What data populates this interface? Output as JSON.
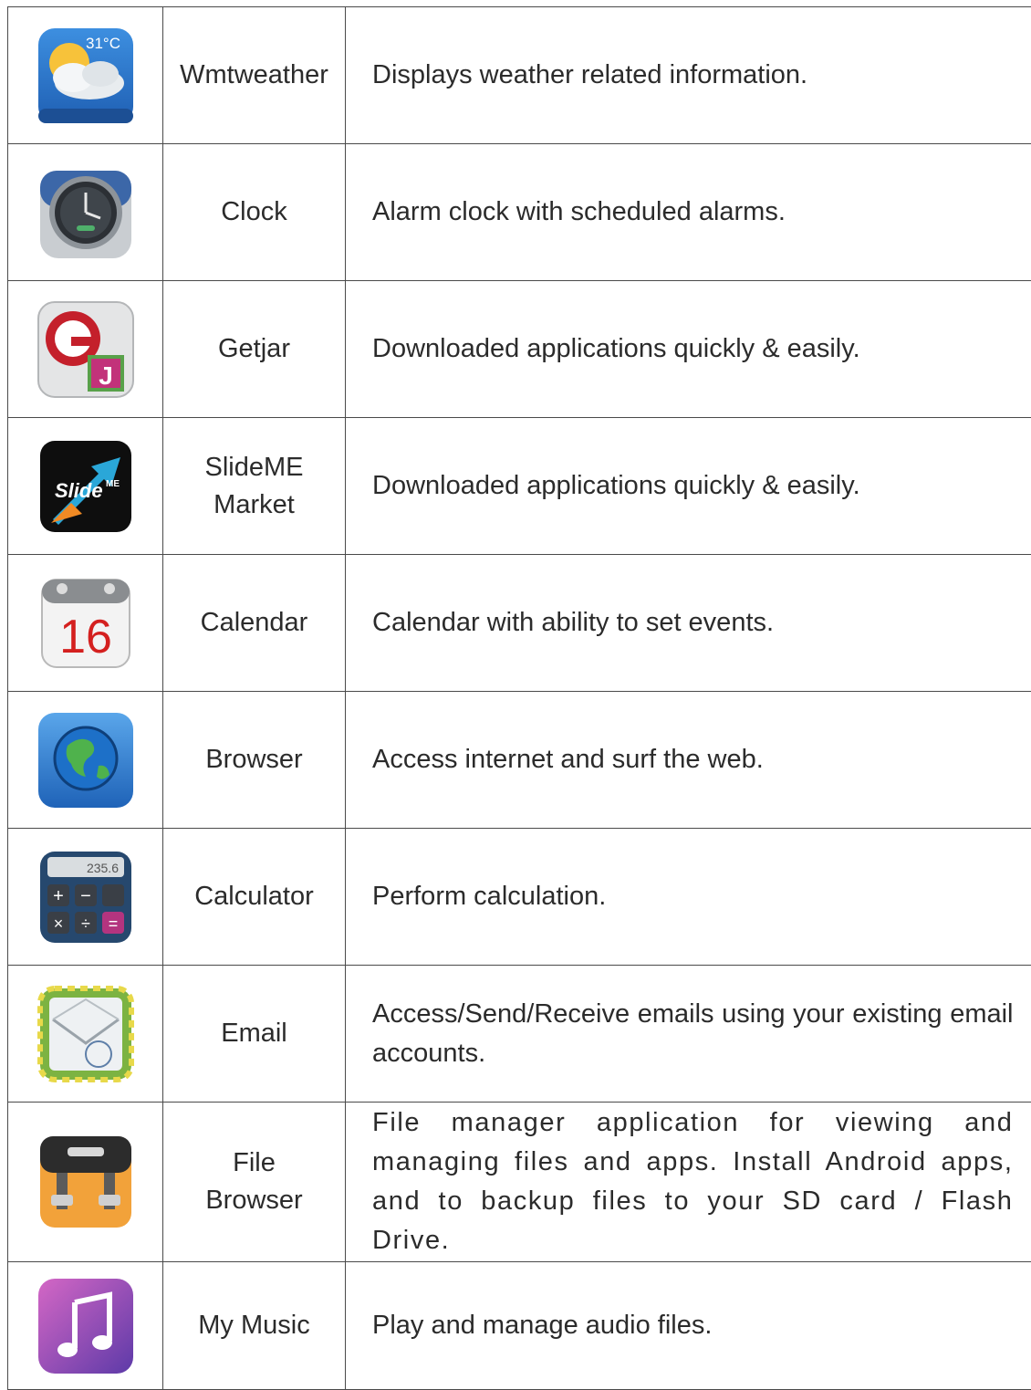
{
  "apps": [
    {
      "name": "Wmtweather",
      "description": "Displays weather related information.",
      "icon": "weather-icon",
      "icon_text": "31°C"
    },
    {
      "name": "Clock",
      "description": "Alarm clock with scheduled alarms.",
      "icon": "alarm-clock-icon"
    },
    {
      "name": "Getjar",
      "description": "Downloaded applications quickly & easily.",
      "icon": "getjar-icon",
      "icon_text": "G J"
    },
    {
      "name": "SlideME\nMarket",
      "description": "Downloaded applications quickly & easily.",
      "icon": "slideme-icon",
      "icon_text": "Slide ME"
    },
    {
      "name": "Calendar",
      "description": "Calendar with ability to set events.",
      "icon": "calendar-icon",
      "icon_text": "16"
    },
    {
      "name": "Browser",
      "description": "Access internet and surf the web.",
      "icon": "globe-icon"
    },
    {
      "name": "Calculator",
      "description": "Perform calculation.",
      "icon": "calculator-icon",
      "icon_text": "235.6"
    },
    {
      "name": "Email",
      "description": "Access/Send/Receive emails using your existing email accounts.",
      "icon": "envelope-icon"
    },
    {
      "name": "File\nBrowser",
      "description": "File manager application for viewing and managing files and apps. Install Android apps, and to backup files to your SD card / Flash Drive.",
      "icon": "file-cabinet-icon"
    },
    {
      "name": "My Music",
      "description": "Play and manage audio files.",
      "icon": "music-note-icon"
    }
  ]
}
